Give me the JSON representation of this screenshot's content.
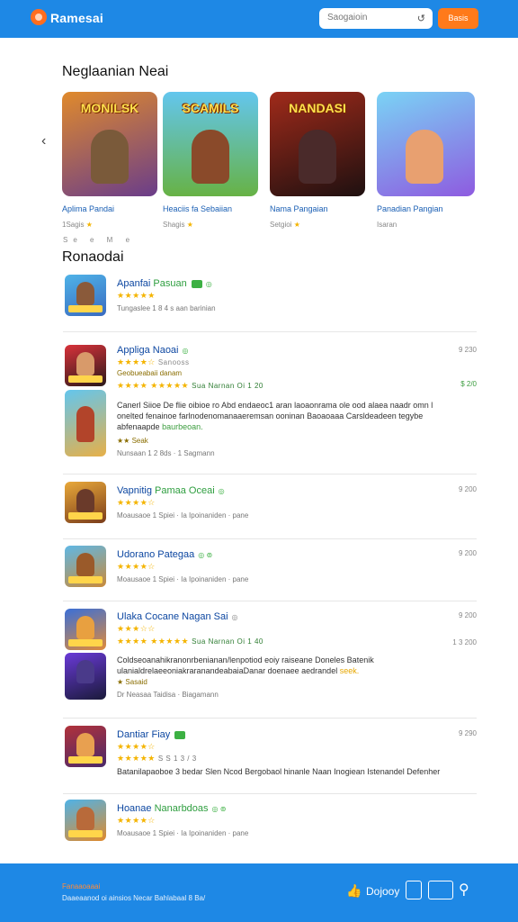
{
  "header": {
    "brand": "Ramesai",
    "search_placeholder": "Saogaioin",
    "action_label": "Basis"
  },
  "featured": {
    "title": "Neglaanian Neai",
    "cards": [
      {
        "art_title": "MONILSK",
        "name": "Aplima Pandai",
        "meta": "1Sagis",
        "colors": [
          "#c2722b",
          "#6a3d8a"
        ]
      },
      {
        "art_title": "SCAMILS",
        "name": "Heaciis fa Sebaiian",
        "meta": "Shagis",
        "colors": [
          "#5fc0e8",
          "#5aa43a"
        ]
      },
      {
        "art_title": "NANDASI",
        "name": "Nama Pangaian",
        "meta": "Setgioi",
        "colors": [
          "#8b1a1a",
          "#241212"
        ]
      },
      {
        "art_title": "",
        "name": "Panadian Pangian",
        "meta": "Isaran",
        "colors": [
          "#7ad3f5",
          "#8e5be0"
        ]
      }
    ],
    "pager_text": "Se  e  M  e"
  },
  "recommended": {
    "title": "Ronaodai",
    "items": [
      {
        "title": "Apanfai",
        "title_hl": "Pasuan",
        "rating": 4,
        "meta": "Tungaslee  1 8 4 s  aan  barinian",
        "price": ""
      },
      {
        "title": "Appliga Naoai",
        "title_hl": "",
        "rating": 3.5,
        "meta": "Nunsaan   1 2 8ds  ·  1 Sagmann",
        "price": "9 230",
        "sub1": "Sanooss",
        "sub2": "Geobueabaii danam",
        "rating_line": "Sua  Narnan  Oi  1 20",
        "price2": "$ 2/0",
        "desc": "Canerl Siioe De flie oibioe ro Abd endaeoc1 aran laoaonrama ole ood alaea naadr omn l onelted fenainoe  farlnodenomanaaeremsan ooninan  Baoaoaaa Carsldeadeen tegybe abfenaapde",
        "desc_hl": "baurbeoan.",
        "sale": "★★ Seak"
      },
      {
        "title": "Vapnitig",
        "title_hl": "Pamaa Oceai",
        "rating": 4,
        "meta": "Moausaoe  1 Spiei  · Ia  Ipoinaniden  · pane",
        "price": "9 200"
      },
      {
        "title": "Udorano Pategaa",
        "title_hl": "",
        "rating": 4,
        "meta": "Moausaoe  1 Spiei  · Ia  Ipoinaniden  · pane",
        "price": "9 200"
      },
      {
        "title": "Ulaka Cocane Nagan Sai",
        "title_hl": "",
        "rating": 3.5,
        "meta": "Dr Neasaa  Taidisa  ·  Biagamann",
        "price": "9 200",
        "rating_line": "Sua  Narnan  Oi  1 40",
        "price2": "1 3 200",
        "desc": "Coldseoanahikranonrbenianan/lenpotiod eoiy raiseane  Doneles Batenik ulanialdrelaeeoniakraranandeabaiaDanar doenaee aedrandel",
        "desc_hl": "seek.",
        "sale": "Sasaid"
      },
      {
        "title": "Dantiar Fiay",
        "title_hl": "",
        "rating": 4,
        "meta": "S  S  1 3 / 3",
        "price": "9 290",
        "rating_line": "★★★★★  ★  S  1 3 / 3",
        "desc": "Batanilapaoboe 3 bedar Slen Ncod Bergobaol hinanle Naan Inogiean Istenandel Defenher"
      },
      {
        "title": "Hoanae",
        "title_hl": "Nanarbdoas",
        "rating": 4,
        "meta": "Moausaoe  1 Spiei  · Ia  Ipoinaniden  · pane",
        "price": ""
      }
    ]
  },
  "footer": {
    "line1": "Fanaaoaaai",
    "line2": "Daaeaanod oi ainsios Necar Bahlabaal 8 Ba/",
    "app_label": "Dojooy"
  },
  "colors": {
    "primary": "#1e88e5",
    "accent": "#ff7a1a",
    "star": "#f4b400",
    "green": "#3cb043",
    "link": "#0d47a1"
  }
}
